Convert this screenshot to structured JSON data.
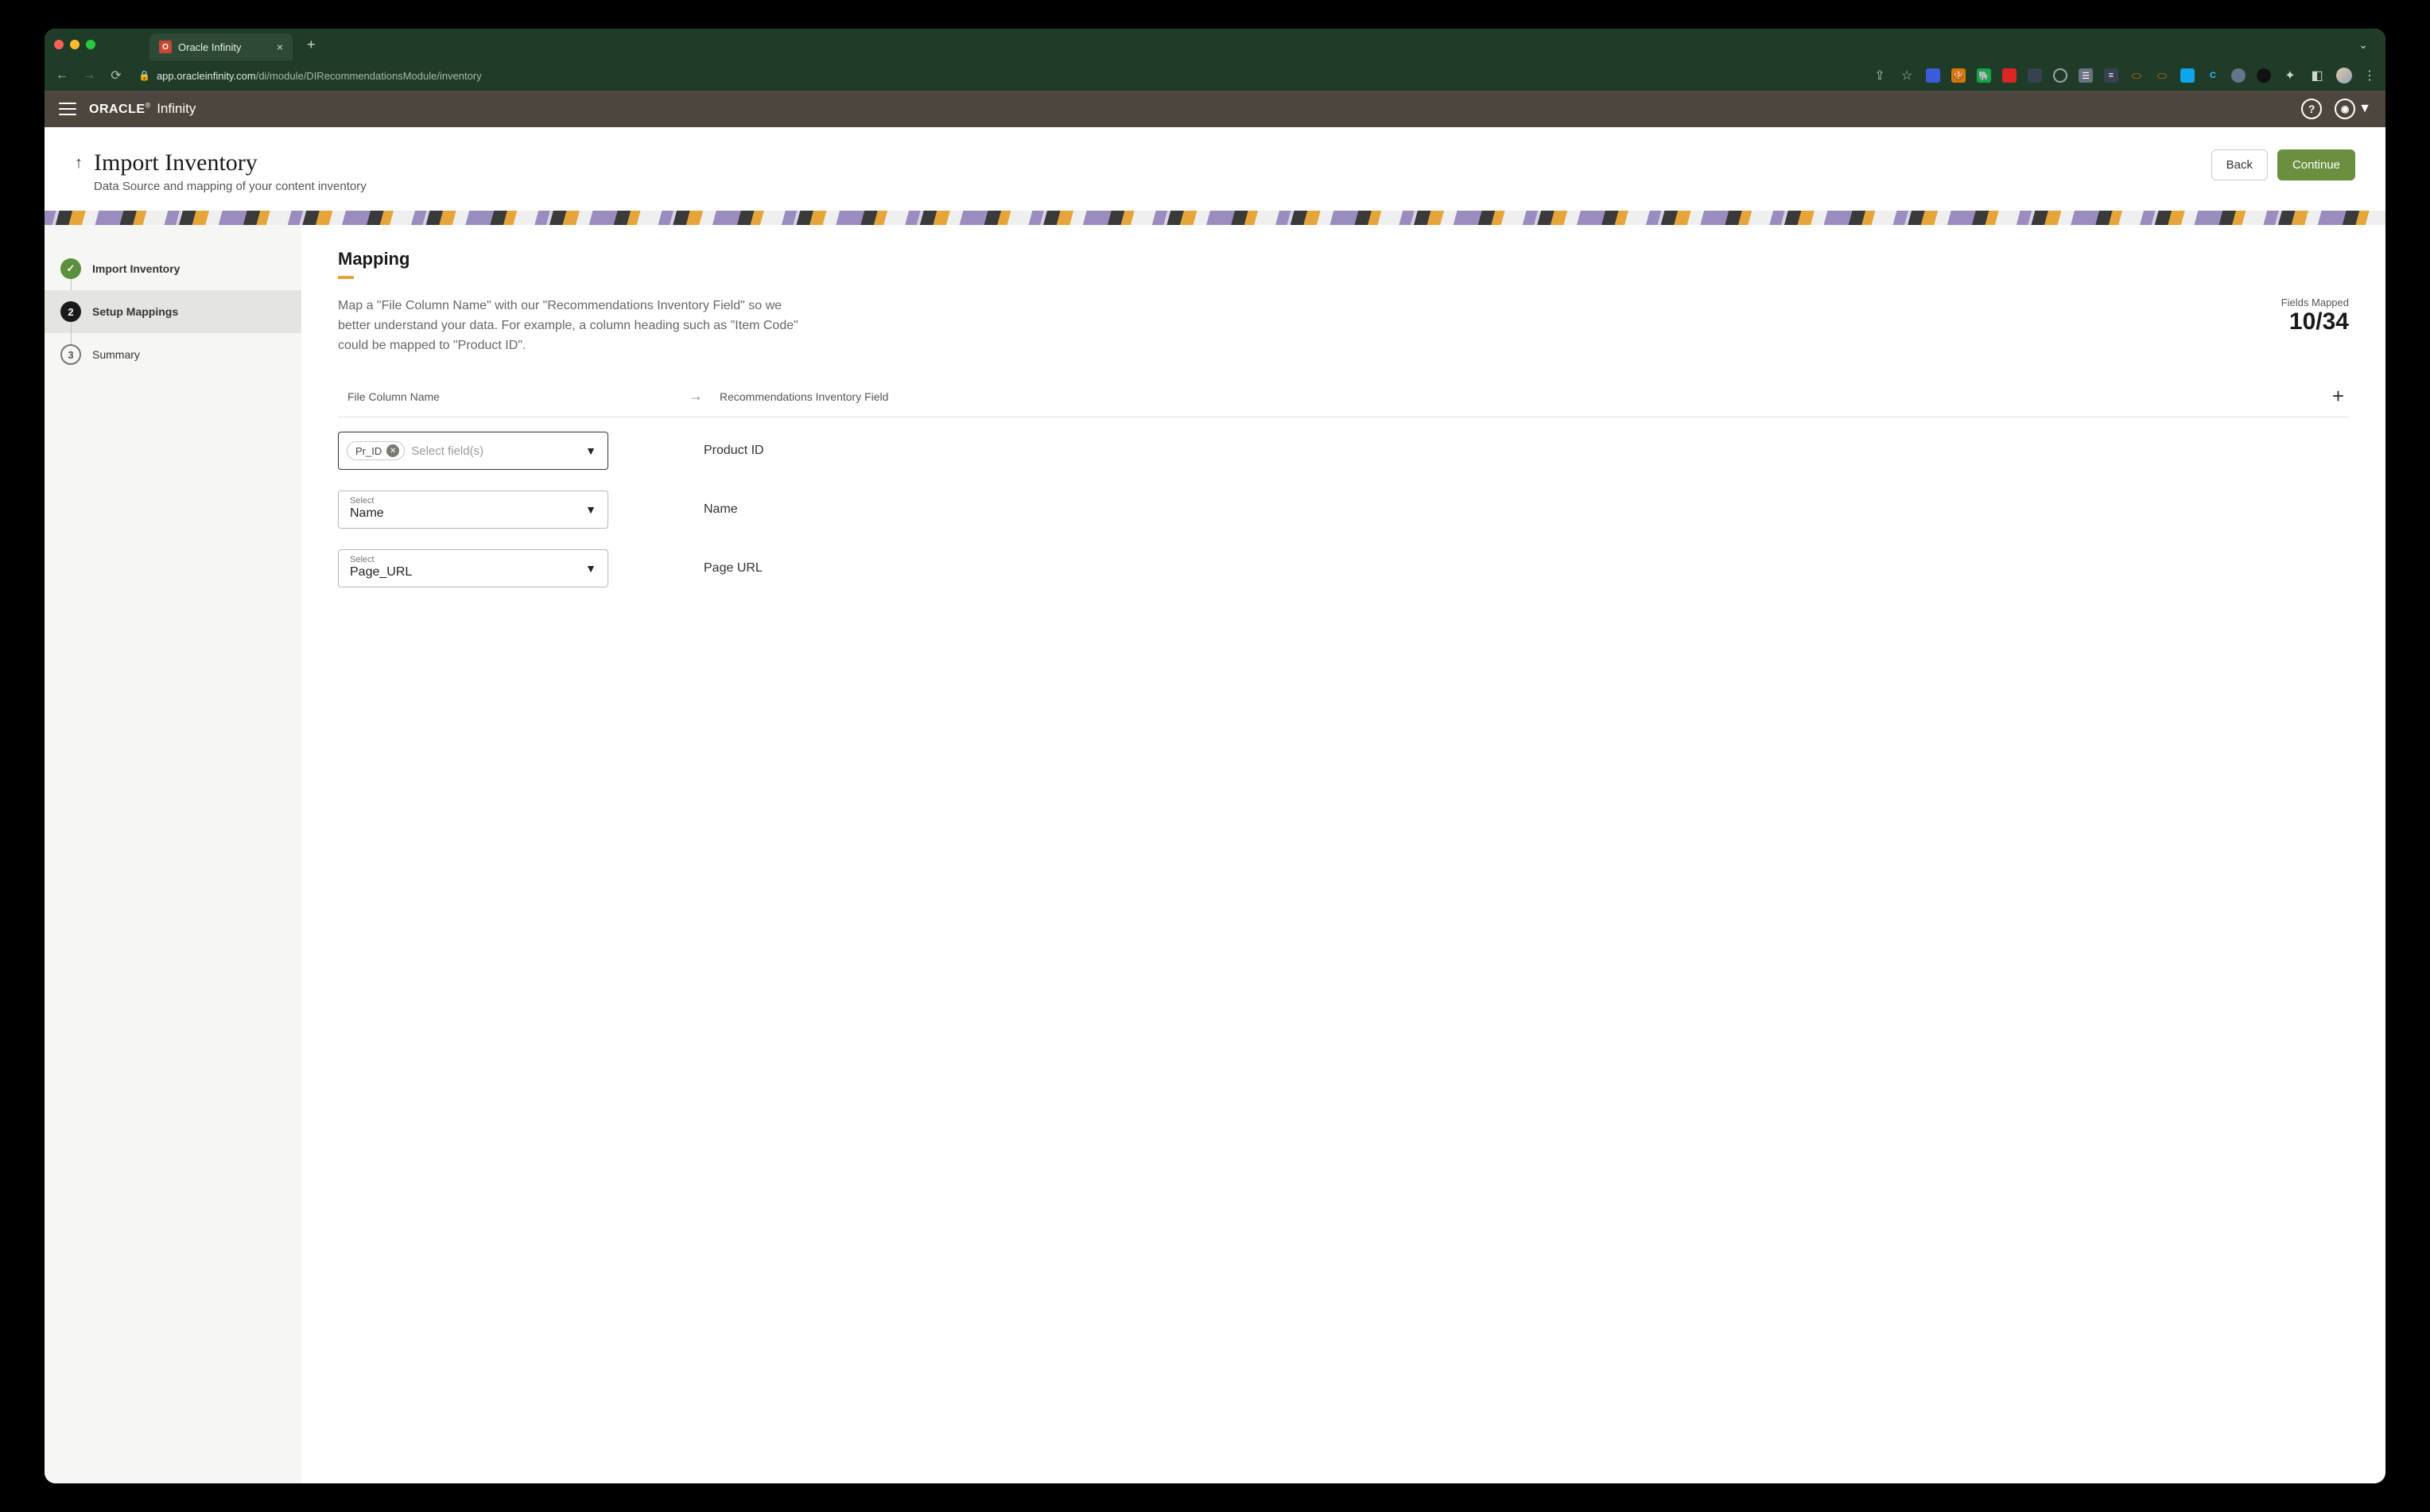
{
  "browser": {
    "tab_title": "Oracle Infinity",
    "url_host": "app.oracleinfinity.com",
    "url_path": "/di/module/DIRecommendationsModule/inventory"
  },
  "app_header": {
    "brand_primary": "ORACLE",
    "brand_product": "Infinity"
  },
  "page": {
    "title": "Import Inventory",
    "subtitle": "Data Source and mapping of your content inventory",
    "back_label": "Back",
    "continue_label": "Continue"
  },
  "steps": [
    {
      "label": "Import Inventory",
      "state": "done"
    },
    {
      "label": "Setup Mappings",
      "state": "current",
      "number": "2"
    },
    {
      "label": "Summary",
      "state": "future",
      "number": "3"
    }
  ],
  "mapping": {
    "heading": "Mapping",
    "description": "Map a \"File Column Name\" with our \"Recommendations Inventory Field\" so we better understand your data. For example, a column heading such as \"Item Code\" could be mapped to \"Product ID\".",
    "fields_mapped_label": "Fields Mapped",
    "fields_mapped_value": "10/34",
    "col_left": "File Column Name",
    "col_right": "Recommendations Inventory Field",
    "select_label": "Select",
    "select_placeholder": "Select field(s)",
    "rows": [
      {
        "type": "multi",
        "chip": "Pr_ID",
        "placeholder": "Select field(s)",
        "target": "Product ID"
      },
      {
        "type": "single",
        "value": "Name",
        "target": "Name"
      },
      {
        "type": "single",
        "value": "Page_URL",
        "target": "Page URL"
      }
    ]
  }
}
